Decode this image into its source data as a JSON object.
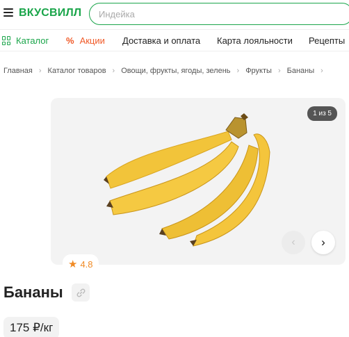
{
  "header": {
    "logo": "ВКУСВИЛЛ",
    "search_placeholder": "Индейка",
    "menu_icon": "hamburger-menu-icon"
  },
  "nav": {
    "items": [
      {
        "label": "Каталог",
        "icon": "grid-icon"
      },
      {
        "label": "Акции",
        "icon": "percent-icon"
      },
      {
        "label": "Доставка и оплата"
      },
      {
        "label": "Карта лояльности"
      },
      {
        "label": "Рецепты"
      }
    ]
  },
  "breadcrumb": [
    "Главная",
    "Каталог товаров",
    "Овощи, фрукты, ягоды, зелень",
    "Фрукты",
    "Бананы"
  ],
  "gallery": {
    "counter": "1 из 5",
    "prev_icon": "chevron-left-icon",
    "next_icon": "chevron-right-icon"
  },
  "product": {
    "rating": "4.8",
    "title": "Бананы",
    "price": "175 ₽/кг",
    "link_icon": "link-icon"
  },
  "colors": {
    "brand_green": "#1aa54a",
    "promo_orange": "#f05a28",
    "rating_orange": "#f08a24"
  }
}
